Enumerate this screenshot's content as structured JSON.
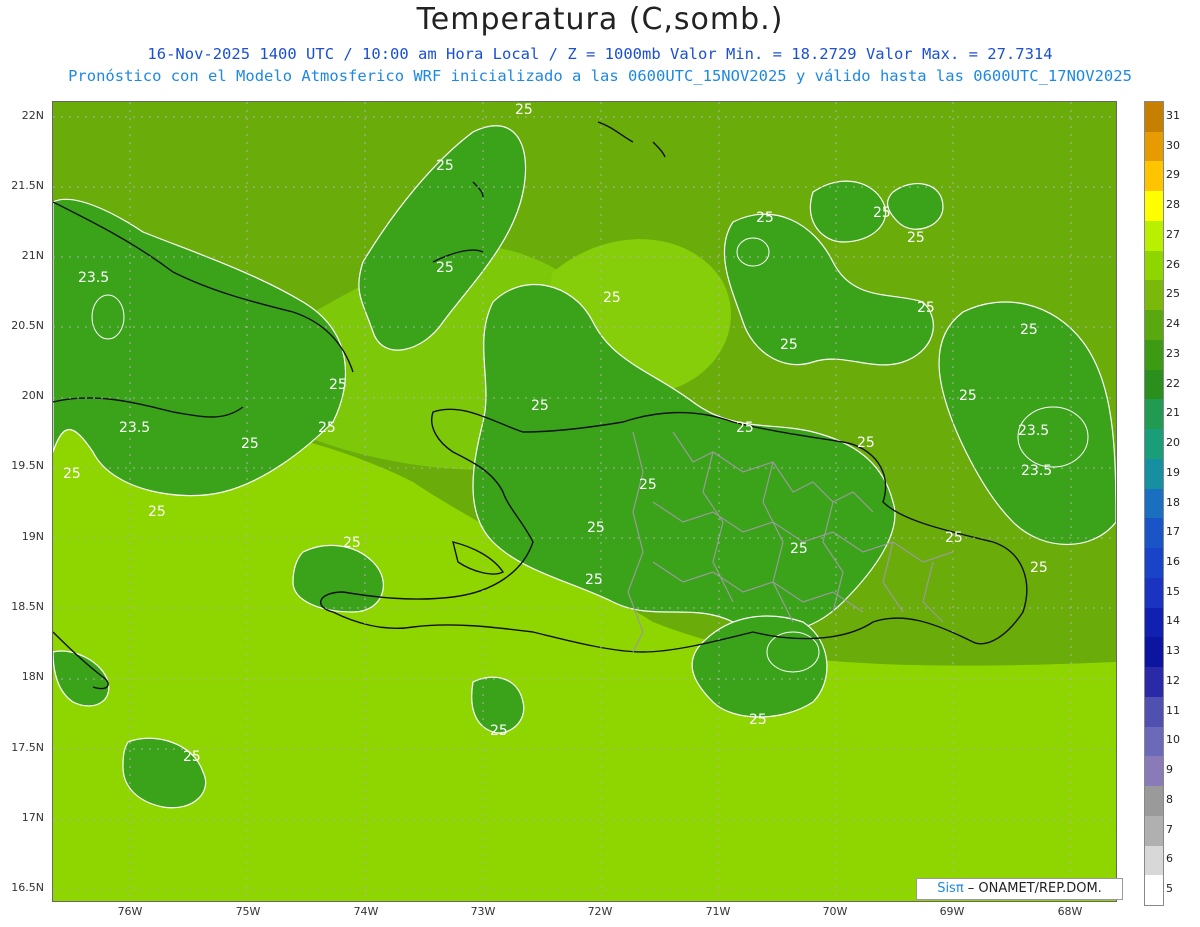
{
  "header": {
    "title": "Temperatura (C,somb.)",
    "subtitle1": "16-Nov-2025 1400 UTC / 10:00 am Hora Local / Z = 1000mb  Valor Min. = 18.2729  Valor Max. = 27.7314",
    "subtitle2": "Pronóstico con el Modelo Atmosferico WRF inicializado a las 0600UTC_15NOV2025 y válido hasta las  0600UTC_17NOV2025"
  },
  "axes": {
    "lat_labels": [
      "22N",
      "21.5N",
      "21N",
      "20.5N",
      "20N",
      "19.5N",
      "19N",
      "18.5N",
      "18N",
      "17.5N",
      "17N",
      "16.5N"
    ],
    "lon_labels": [
      "76W",
      "75W",
      "74W",
      "73W",
      "72W",
      "71W",
      "70W",
      "69W",
      "68W"
    ]
  },
  "contour_labels": [
    "25",
    "25",
    "25",
    "25",
    "25",
    "25",
    "25",
    "25",
    "25",
    "25",
    "25",
    "25",
    "25",
    "25",
    "25",
    "25",
    "25",
    "25",
    "25",
    "25",
    "25",
    "25",
    "25",
    "25",
    "25",
    "25",
    "25",
    "25",
    "25",
    "23.5",
    "23.5",
    "23.5",
    "23.5"
  ],
  "colorbar": {
    "labels": [
      "31",
      "30",
      "29",
      "28",
      "27",
      "26",
      "25",
      "24",
      "23",
      "22",
      "21",
      "20",
      "19",
      "18",
      "17",
      "16",
      "15",
      "14",
      "13",
      "12",
      "11",
      "10",
      "9",
      "8",
      "7",
      "6",
      "5"
    ],
    "colors": [
      "#c77f00",
      "#e69b00",
      "#ffc400",
      "#ffff00",
      "#b8f000",
      "#8fd600",
      "#7ab80a",
      "#5aa80f",
      "#3c9b12",
      "#2b8f1e",
      "#219a52",
      "#1a9e7a",
      "#168fa0",
      "#1a6fc0",
      "#1a55c8",
      "#1a44c8",
      "#1a33c0",
      "#1020b0",
      "#0c15a0",
      "#2a2aa8",
      "#5050b0",
      "#6a6ab8",
      "#8a7ab8",
      "#9a9a9a",
      "#b0b0b0",
      "#d8d8d8",
      "#ffffff"
    ]
  },
  "credit": {
    "sis": "Sisπ",
    "text": " – ONAMET/REP.DOM."
  }
}
